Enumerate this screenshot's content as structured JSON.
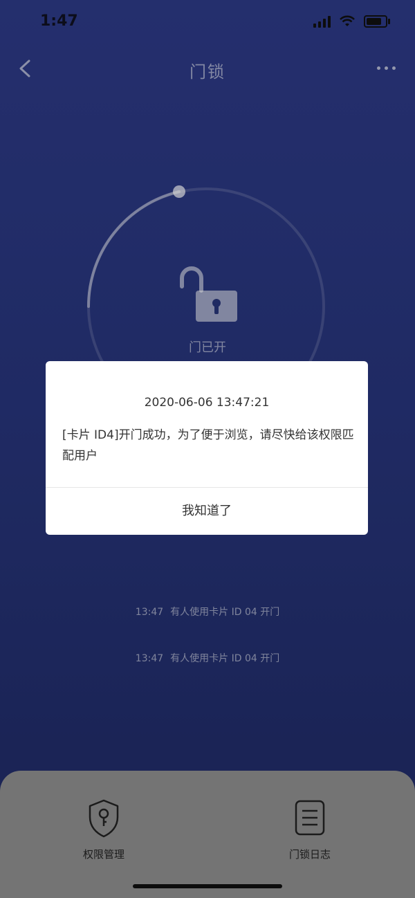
{
  "status_bar": {
    "time": "1:47"
  },
  "header": {
    "title": "门锁"
  },
  "lock": {
    "status": "门已开"
  },
  "logs": [
    {
      "time": "13:47",
      "text": "有人使用卡片 ID 04 开门"
    },
    {
      "time": "13:47",
      "text": "有人使用卡片 ID 04 开门"
    }
  ],
  "dialog": {
    "datetime": "2020-06-06 13:47:21",
    "message": "[卡片 ID4]开门成功，为了便于浏览，请尽快给该权限匹配用户",
    "confirm_label": "我知道了"
  },
  "bottom_nav": {
    "items": [
      {
        "label": "权限管理",
        "icon": "shield-key-icon"
      },
      {
        "label": "门锁日志",
        "icon": "log-list-icon"
      }
    ]
  }
}
